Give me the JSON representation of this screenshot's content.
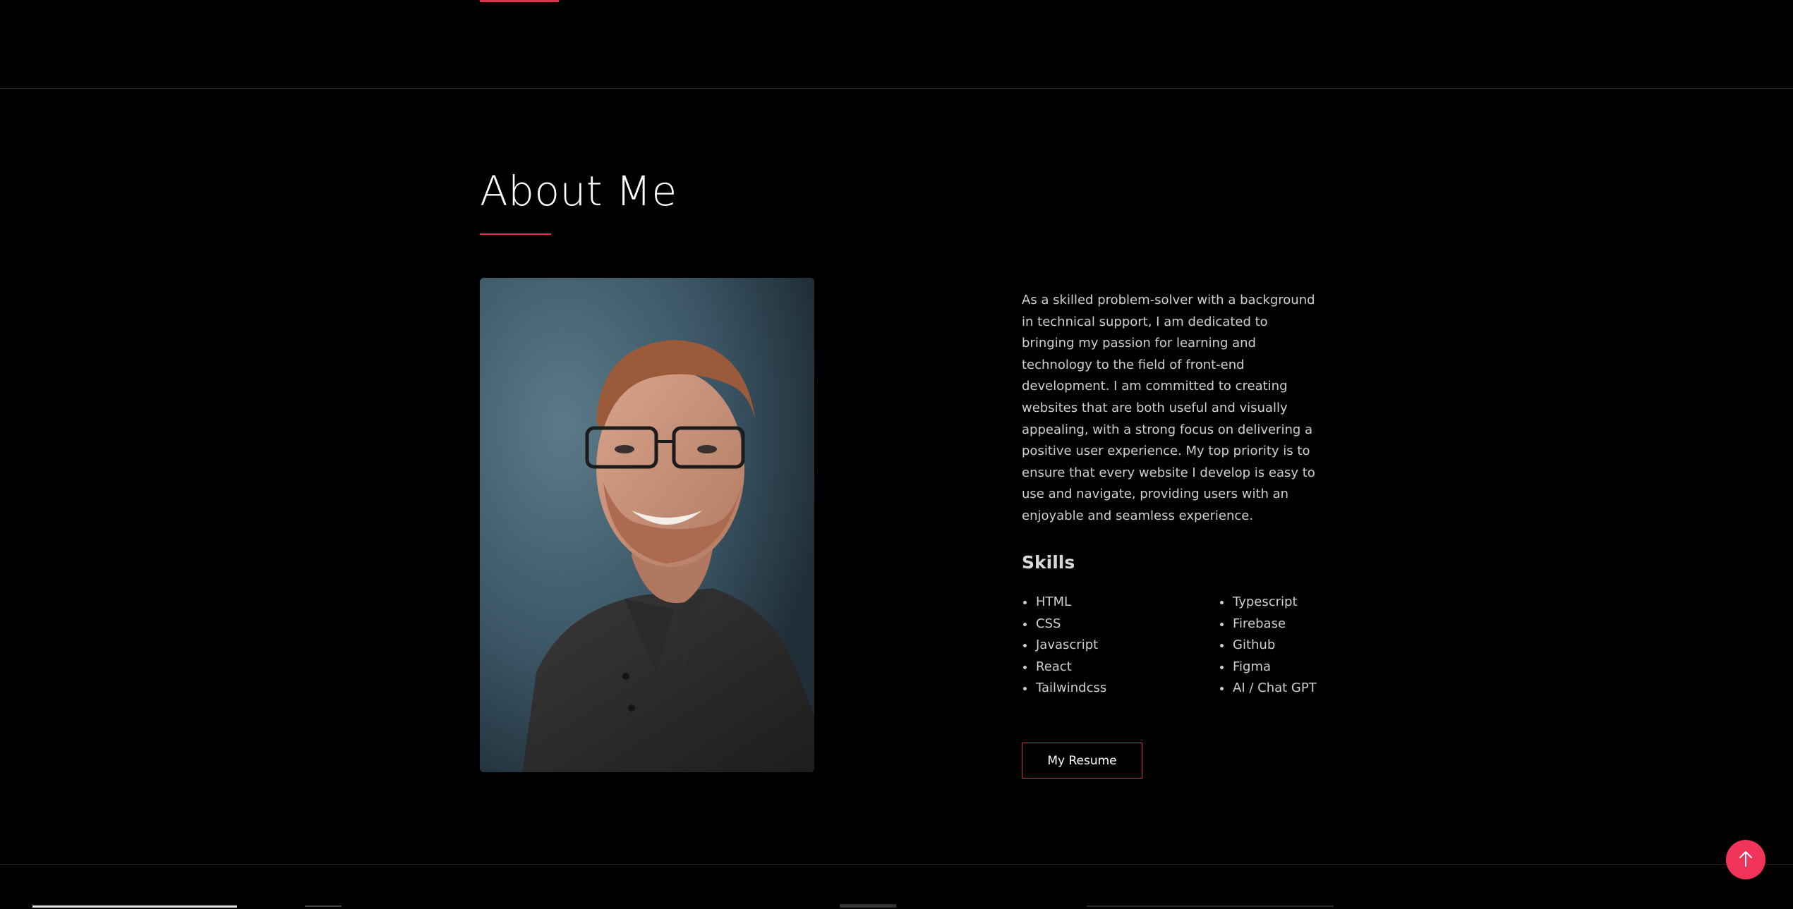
{
  "about": {
    "title": "About Me",
    "portrait_alt": "Portrait photo",
    "bio": "As a skilled problem-solver with a background in technical support, I am dedicated to bringing my passion for learning and technology to the field of front-end development. I am committed to creating websites that are both useful and visually appealing, with a strong focus on delivering a positive user experience. My top priority is to ensure that every website I develop is easy to use and navigate, providing users with an enjoyable and seamless experience."
  },
  "skills": {
    "title": "Skills",
    "column_1": [
      "HTML",
      "CSS",
      "Javascript",
      "React",
      "Tailwindcss"
    ],
    "column_2": [
      "Typescript",
      "Firebase",
      "Github",
      "Figma",
      "AI / Chat GPT"
    ]
  },
  "resume_button": {
    "label": "My Resume"
  },
  "back_to_top": {
    "icon": "arrow-up-icon"
  },
  "colors": {
    "accent": "#e0304f",
    "background": "#000000",
    "text": "#cfcfcf"
  }
}
